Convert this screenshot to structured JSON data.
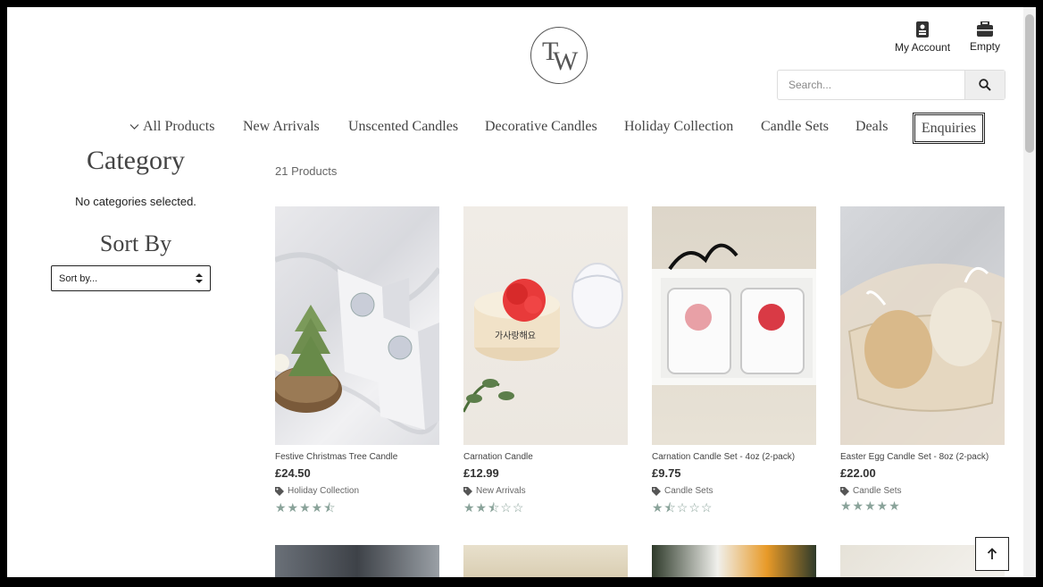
{
  "header": {
    "account_label": "My Account",
    "cart_label": "Empty",
    "search_placeholder": "Search..."
  },
  "nav": {
    "items": [
      "All Products",
      "New Arrivals",
      "Unscented Candles",
      "Decorative Candles",
      "Holiday Collection",
      "Candle Sets",
      "Deals"
    ],
    "enquiries": "Enquiries"
  },
  "sidebar": {
    "category_title": "Category",
    "no_categories": "No categories selected.",
    "sort_title": "Sort By",
    "sort_value": "Sort by..."
  },
  "main": {
    "product_count": "21 Products",
    "products": [
      {
        "name": "Festive Christmas Tree Candle",
        "price": "£24.50",
        "category": "Holiday Collection",
        "rating": 4.5
      },
      {
        "name": "Carnation Candle",
        "price": "£12.99",
        "category": "New Arrivals",
        "rating": 2.5
      },
      {
        "name": "Carnation Candle Set - 4oz (2-pack)",
        "price": "£9.75",
        "category": "Candle Sets",
        "rating": 1.5
      },
      {
        "name": "Easter Egg Candle Set - 8oz (2-pack)",
        "price": "£22.00",
        "category": "Candle Sets",
        "rating": 5
      }
    ]
  },
  "colors": {
    "star": "#8aa39a",
    "text": "#444444"
  },
  "icons": {
    "account": "person-badge-icon",
    "cart": "briefcase-icon",
    "search": "search-icon",
    "back_to_top": "arrow-up-icon",
    "category_tag": "tag-icon",
    "nav_dropdown": "chevron-down-icon",
    "sort_arrows": "sort-arrows-icon"
  }
}
